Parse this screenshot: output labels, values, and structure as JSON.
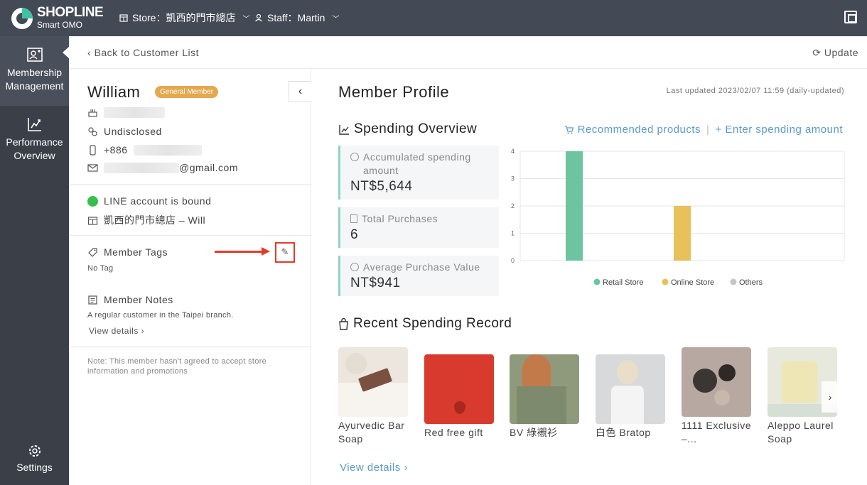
{
  "topbar": {
    "logo_word": "SHOPLINE",
    "logo_sub": "Smart OMO",
    "store_label": "Store：凱西的門市總店",
    "staff_label": "Staff：Martin"
  },
  "sidebar": {
    "items": [
      {
        "label_line1": "Membership",
        "label_line2": "Management",
        "icon": "member-card-icon"
      },
      {
        "label_line1": "Performance",
        "label_line2": "Overview",
        "icon": "chart-up-icon"
      }
    ],
    "settings_label": "Settings"
  },
  "subheader": {
    "back_label": "Back to Customer List",
    "update_label": "Update"
  },
  "profile": {
    "name": "William",
    "badge": "General Member",
    "gender": "Undisclosed",
    "phone_prefix": "+886",
    "email_suffix": "@gmail.com",
    "line_status": "LINE account is bound",
    "store_staff": "凱西的門市總店 – Will",
    "tags_title": "Member Tags",
    "tags_value": "No Tag",
    "notes_title": "Member Notes",
    "notes_value": "A regular customer in the Taipei branch.",
    "notes_link": "View details",
    "consent_note": "Note: This member hasn't agreed to accept store information and promotions"
  },
  "main": {
    "title": "Member Profile",
    "last_updated": "Last updated 2023/02/07 11:59 (daily-updated)",
    "spending_title": "Spending Overview",
    "recommended_label": "Recommended products",
    "enter_amount_label": "+ Enter spending amount",
    "stats": [
      {
        "label": "Accumulated spending amount",
        "value": "NT$5,644"
      },
      {
        "label": "Total Purchases",
        "value": "6"
      },
      {
        "label": "Average Purchase Value",
        "value": "NT$941"
      }
    ],
    "recent_title": "Recent Spending Record",
    "products": [
      {
        "name": "Ayurvedic Bar Soap"
      },
      {
        "name": "Red free gift"
      },
      {
        "name": "BV 綠襯衫"
      },
      {
        "name": "白色 Bratop"
      },
      {
        "name": "1111 Exclusive –..."
      },
      {
        "name": "Aleppo Laurel Soap"
      }
    ],
    "view_details": "View details"
  },
  "colors": {
    "topbar": "#444a55",
    "sidebar": "#3a3f48",
    "accent_link": "#5b9bc8",
    "badge": "#e5a84f",
    "retail": "#6cc4a1",
    "online": "#e8c15a",
    "others": "#c4c6cc",
    "highlight": "#e03c2c"
  },
  "chart_data": {
    "type": "bar",
    "categories": [
      "Retail Store",
      "Online Store",
      "Others"
    ],
    "series": [
      {
        "name": "Retail Store",
        "values": [
          4,
          0,
          0
        ]
      },
      {
        "name": "Online Store",
        "values": [
          0,
          2,
          0
        ]
      },
      {
        "name": "Others",
        "values": [
          0,
          0,
          0
        ]
      }
    ],
    "y_ticks": [
      "0",
      "1",
      "2",
      "3",
      "4"
    ],
    "ylim": [
      0,
      4
    ],
    "grid": true,
    "legend": "bottom"
  }
}
